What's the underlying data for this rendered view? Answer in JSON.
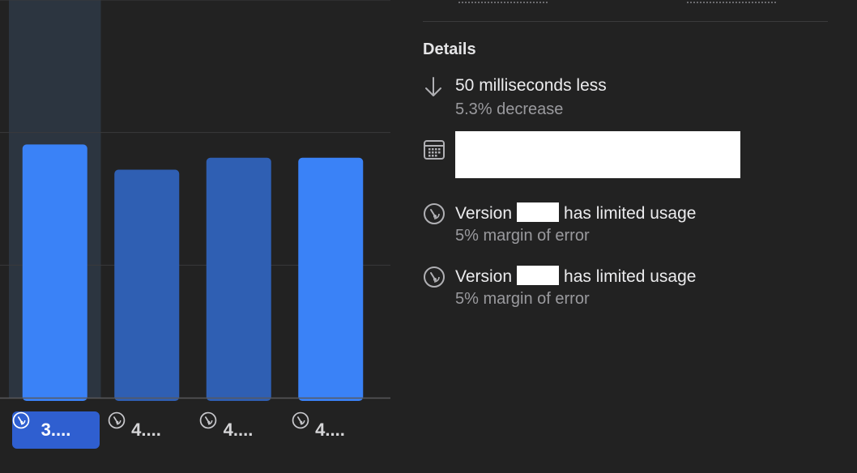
{
  "chart_data": {
    "type": "bar",
    "categories": [
      "3....",
      "4....",
      "4....",
      "4...."
    ],
    "values": [
      955,
      860,
      905,
      905
    ],
    "selected_index": 0,
    "bar_colors": [
      "#3a82f7",
      "#2f5fb3",
      "#2f5fb3",
      "#3a82f7"
    ],
    "ylim": [
      0,
      1500
    ],
    "grid": true
  },
  "colors": {
    "background": "#222222",
    "accent_bright": "#3a82f7",
    "accent_dim": "#2f5fb3",
    "selected_tab": "#2f5fd0",
    "highlight_column": "#2c3540",
    "secondary_text": "#9a9a9e"
  },
  "details": {
    "title": "Details",
    "change": {
      "icon": "arrow-down-icon",
      "primary": "50 milliseconds less",
      "secondary": "5.3% decrease"
    },
    "date": {
      "icon": "calendar-icon"
    },
    "versions": [
      {
        "icon": "gauge-icon",
        "prefix": "Version",
        "suffix": "has limited usage",
        "secondary": "5% margin of error"
      },
      {
        "icon": "gauge-icon",
        "prefix": "Version",
        "suffix": "has limited usage",
        "secondary": "5% margin of error"
      }
    ]
  }
}
